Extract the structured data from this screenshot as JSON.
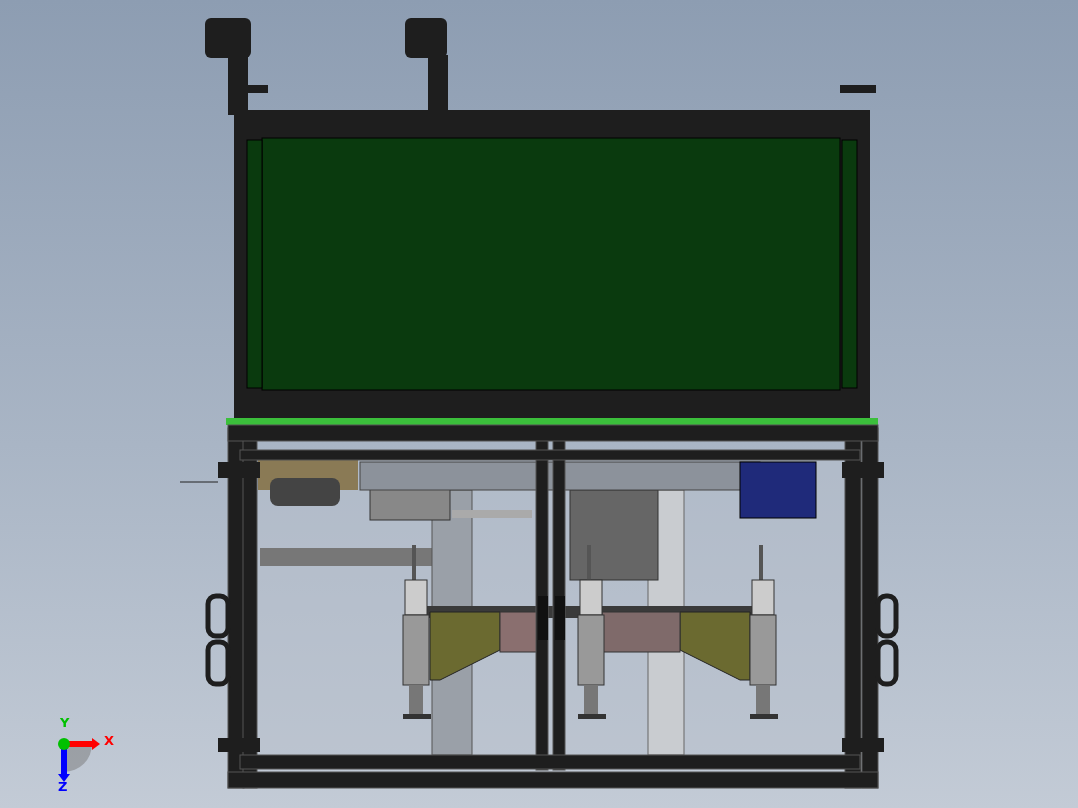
{
  "viewport": {
    "triad": {
      "axes": [
        {
          "label": "X",
          "color": "#ff0000"
        },
        {
          "label": "Y",
          "color": "#00c000"
        },
        {
          "label": "Z",
          "color": "#0000ff"
        }
      ]
    }
  }
}
